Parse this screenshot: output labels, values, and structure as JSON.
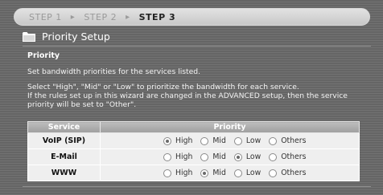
{
  "steps": [
    "STEP 1",
    "STEP 2",
    "STEP 3"
  ],
  "active_step": 2,
  "page_title": "Priority Setup",
  "section_label": "Priority",
  "description_1": "Set bandwidth priorities for the services listed.",
  "description_2": "Select \"High\", \"Mid\" or \"Low\" to prioritize the bandwidth for each service.",
  "description_3": "If the rules set up in this wizard are changed in the ADVANCED setup, then the service priority will be set to \"Other\".",
  "table": {
    "headers": [
      "Service",
      "Priority"
    ],
    "option_labels": [
      "High",
      "Mid",
      "Low",
      "Others"
    ],
    "rows": [
      {
        "service": "VoIP (SIP)",
        "selected": "High"
      },
      {
        "service": "E-Mail",
        "selected": "Low"
      },
      {
        "service": "WWW",
        "selected": "Mid"
      }
    ]
  },
  "icons": {
    "title_icon": "folder-icon",
    "step_separator": "chevron-right-icon"
  }
}
